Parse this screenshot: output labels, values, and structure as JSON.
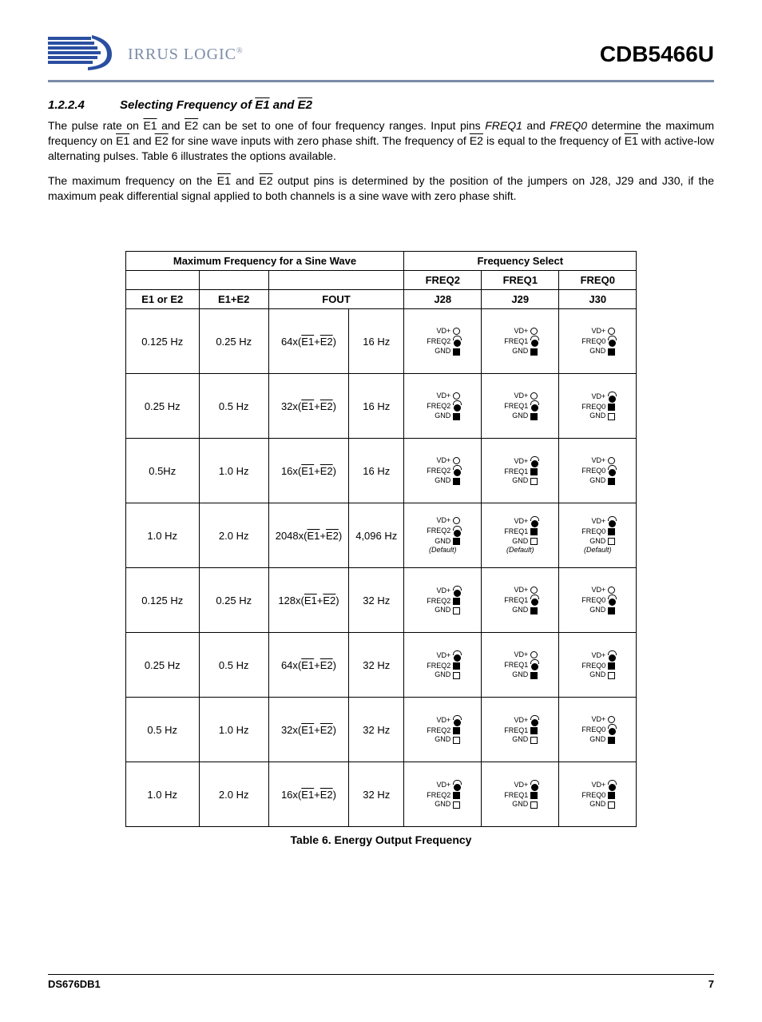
{
  "header": {
    "logo_text": "IRRUS LOGIC",
    "part_number": "CDB5466U"
  },
  "section": {
    "number": "1.2.2.4",
    "title_prefix": "Selecting Frequency of ",
    "title_e1": "E1",
    "title_and": " and ",
    "title_e2": "E2"
  },
  "para1": {
    "t0": "The pulse rate on ",
    "e1": "E1",
    "t1": " and ",
    "e2": "E2",
    "t2": " can be set to one of four frequency ranges. Input pins ",
    "f1": "FREQ1",
    "t3": " and ",
    "f0": "FREQ0",
    "t4": " determine the maximum frequency on ",
    "e1b": "E1",
    "t5": " and ",
    "e2b": "E2",
    "t6": " for sine wave inputs with zero phase shift. The frequency of ",
    "e2c": "E2",
    "t7": " is equal to the frequency of ",
    "e1c": "E1",
    "t8": " with active-low alternating pulses. Table 6 illustrates the options available."
  },
  "para2": {
    "t0": "The maximum frequency on the ",
    "e1": "E1",
    "t1": " and ",
    "e2": "E2",
    "t2": " output pins is determined by the position of the jumpers on J28, J29 and J30, if the maximum peak differential signal applied to both channels is a sine wave with zero phase shift."
  },
  "table": {
    "hdr_max": "Maximum Frequency for a Sine Wave",
    "hdr_fsel": "Frequency Select",
    "hdr_freq2": "FREQ2",
    "hdr_freq1": "FREQ1",
    "hdr_freq0": "FREQ0",
    "hdr_e": "E1 or E2",
    "hdr_ee": "E1+E2",
    "hdr_fout": "FOUT",
    "hdr_j28": "J28",
    "hdr_j29": "J29",
    "hdr_j30": "J30",
    "caption": "Table 6. Energy Output Frequency",
    "jlabels": {
      "vd": "VD+",
      "f2": "FREQ2",
      "f1": "FREQ1",
      "f0": "FREQ0",
      "gnd": "GND",
      "def": "(Default)"
    },
    "rows": [
      {
        "e": "0.125 Hz",
        "ee": "0.25 Hz",
        "mult": "64x",
        "fout": "16 Hz",
        "j28": "gnd",
        "j29": "gnd",
        "j30": "gnd",
        "def": false
      },
      {
        "e": "0.25 Hz",
        "ee": "0.5 Hz",
        "mult": "32x",
        "fout": "16 Hz",
        "j28": "gnd",
        "j29": "gnd",
        "j30": "vd",
        "def": false
      },
      {
        "e": "0.5Hz",
        "ee": "1.0 Hz",
        "mult": "16x",
        "fout": "16 Hz",
        "j28": "gnd",
        "j29": "vd",
        "j30": "gnd",
        "def": false
      },
      {
        "e": "1.0 Hz",
        "ee": "2.0 Hz",
        "mult": "2048x",
        "fout": "4,096 Hz",
        "j28": "gnd",
        "j29": "vd",
        "j30": "vd",
        "def": true
      },
      {
        "e": "0.125 Hz",
        "ee": "0.25 Hz",
        "mult": "128x",
        "fout": "32 Hz",
        "j28": "vd",
        "j29": "gnd",
        "j30": "gnd",
        "def": false
      },
      {
        "e": "0.25 Hz",
        "ee": "0.5 Hz",
        "mult": "64x",
        "fout": "32 Hz",
        "j28": "vd",
        "j29": "gnd",
        "j30": "vd",
        "def": false
      },
      {
        "e": "0.5 Hz",
        "ee": "1.0 Hz",
        "mult": "32x",
        "fout": "32 Hz",
        "j28": "vd",
        "j29": "vd",
        "j30": "gnd",
        "def": false
      },
      {
        "e": "1.0 Hz",
        "ee": "2.0 Hz",
        "mult": "16x",
        "fout": "32 Hz",
        "j28": "vd",
        "j29": "vd",
        "j30": "vd",
        "def": false
      }
    ]
  },
  "footer": {
    "doc": "DS676DB1",
    "page": "7"
  }
}
